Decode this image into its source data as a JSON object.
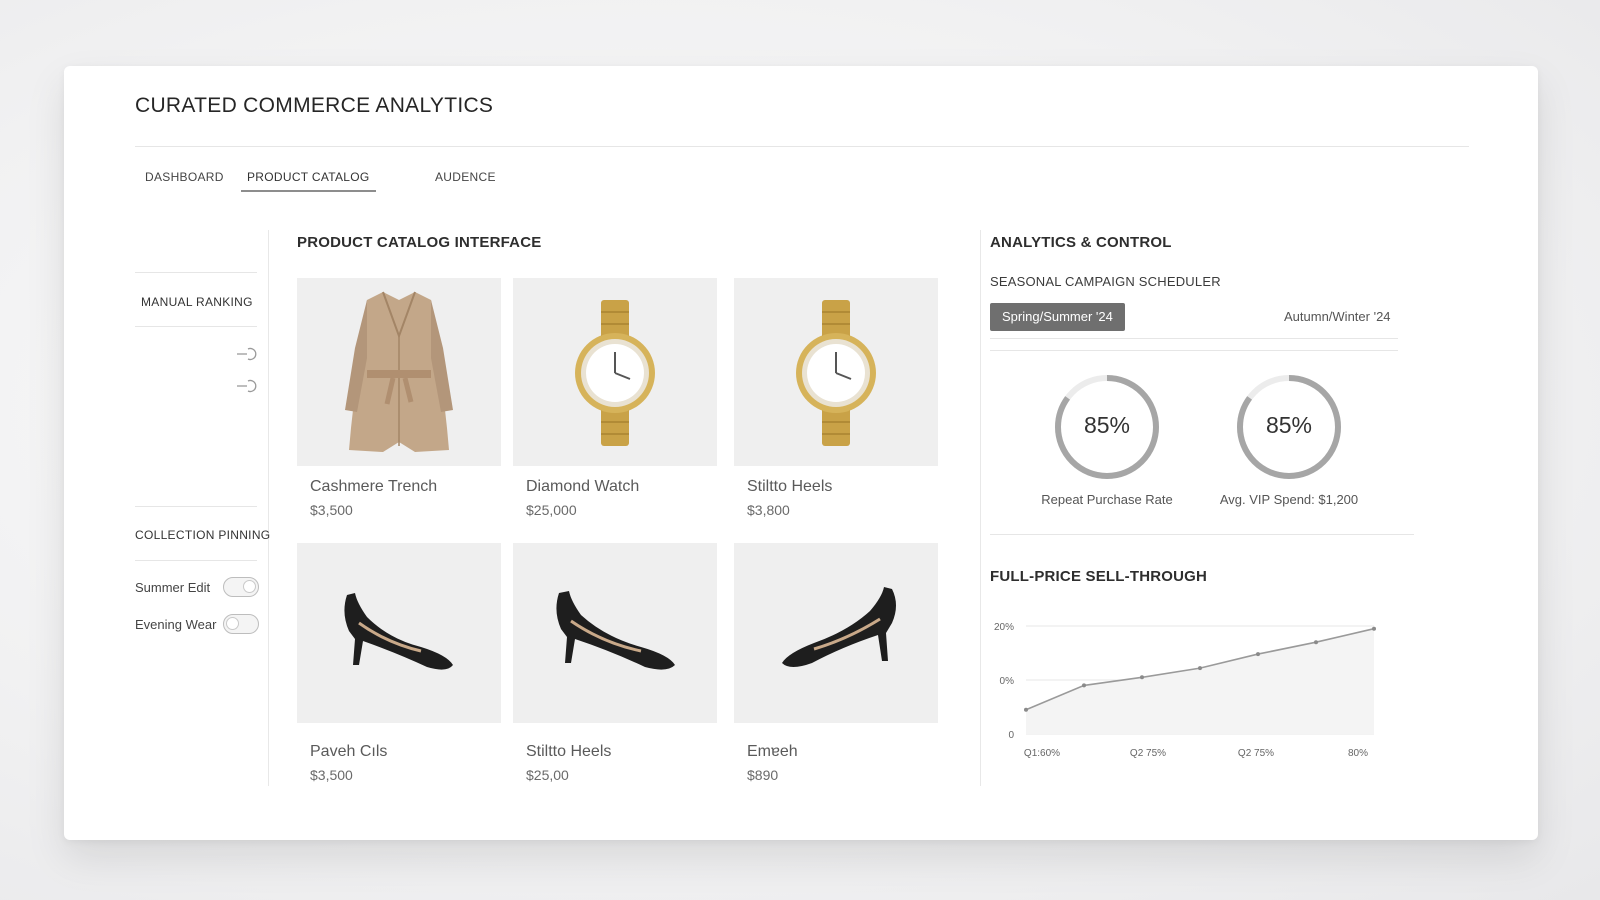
{
  "app": {
    "title": "CURATED COMMERCE ANALYTICS"
  },
  "tabs": [
    {
      "label": "DASHBOARD",
      "active": false
    },
    {
      "label": "PRODUCT CATALOG",
      "active": true
    },
    {
      "label": "AUDENCE",
      "active": false
    }
  ],
  "sidebar": {
    "ranking_title": "MANUAL RANKING",
    "pinning_title": "COLLECTION PINNING",
    "pins": [
      {
        "label": "Summer Edit",
        "on": true
      },
      {
        "label": "Evening Wear",
        "on": false
      }
    ]
  },
  "catalog": {
    "title": "PRODUCT CATALOG INTERFACE",
    "products": [
      {
        "name": "Cashmere Trench",
        "price": "$3,500",
        "icon": "coat-icon"
      },
      {
        "name": "Diamond Watch",
        "price": "$25,000",
        "icon": "watch-icon"
      },
      {
        "name": "Stiltto Heels",
        "price": "$3,800",
        "icon": "watch-icon"
      },
      {
        "name": "Paveh Cıls",
        "price": "$3,500",
        "icon": "heel-icon"
      },
      {
        "name": "Stiltto Heels",
        "price": "$25,00",
        "icon": "heel-icon"
      },
      {
        "name": "Emɐeh",
        "price": "$890",
        "icon": "heel-icon"
      }
    ]
  },
  "analytics": {
    "title": "ANALYTICS & CONTROL",
    "scheduler_title": "SEASONAL CAMPAIGN SCHEDULER",
    "seasons": [
      {
        "label": "Spring/Summer '24",
        "active": true
      },
      {
        "label": "Autumn/Winter '24",
        "active": false
      }
    ],
    "gauges": [
      {
        "value": "85%",
        "fraction": 0.85,
        "label": "Repeat Purchase Rate"
      },
      {
        "value": "85%",
        "fraction": 0.85,
        "label": "Avg. VIP Spend: $1,200"
      }
    ],
    "chart_title": "FULL-PRICE SELL-THROUGH"
  },
  "colors": {
    "accent": "#6f6f6f",
    "line": "#9a9a9a"
  },
  "chart_data": {
    "type": "line",
    "title": "FULL-PRICE SELL-THROUGH",
    "y_ticks": [
      "0",
      "0%",
      "20%"
    ],
    "x_ticks": [
      "Q1:60%",
      "Q2 75%",
      "Q2 75%",
      "80%"
    ],
    "values": [
      0.45,
      0.9,
      1.05,
      1.22,
      1.48,
      1.7,
      1.95
    ],
    "ylim": [
      0,
      2
    ],
    "grid": true
  }
}
